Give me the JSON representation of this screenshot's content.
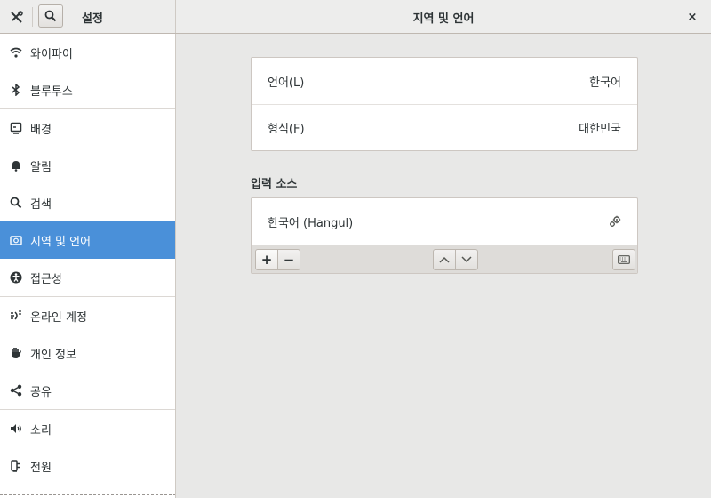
{
  "titlebar": {
    "left_title": "설정",
    "center_title": "지역 및 언어",
    "close_label": "×"
  },
  "sidebar": {
    "items": [
      {
        "label": "와이파이",
        "icon": "wifi-icon"
      },
      {
        "label": "블루투스",
        "icon": "bluetooth-icon"
      },
      {
        "label": "배경",
        "icon": "background-icon"
      },
      {
        "label": "알림",
        "icon": "bell-icon"
      },
      {
        "label": "검색",
        "icon": "search-icon"
      },
      {
        "label": "지역 및 언어",
        "icon": "region-icon",
        "selected": true
      },
      {
        "label": "접근성",
        "icon": "accessibility-icon"
      },
      {
        "label": "온라인 계정",
        "icon": "online-accounts-icon"
      },
      {
        "label": "개인 정보",
        "icon": "privacy-hand-icon"
      },
      {
        "label": "공유",
        "icon": "share-icon"
      },
      {
        "label": "소리",
        "icon": "speaker-icon"
      },
      {
        "label": "전원",
        "icon": "power-plug-icon"
      }
    ]
  },
  "language_panel": {
    "language_label": "언어(L)",
    "language_value": "한국어",
    "formats_label": "형식(F)",
    "formats_value": "대한민국"
  },
  "input_sources": {
    "title": "입력 소스",
    "sources": [
      {
        "name": "한국어 (Hangul)"
      }
    ],
    "add_label": "+",
    "remove_label": "−"
  },
  "colors": {
    "selection": "#4a90d9",
    "background": "#e8e8e7"
  }
}
